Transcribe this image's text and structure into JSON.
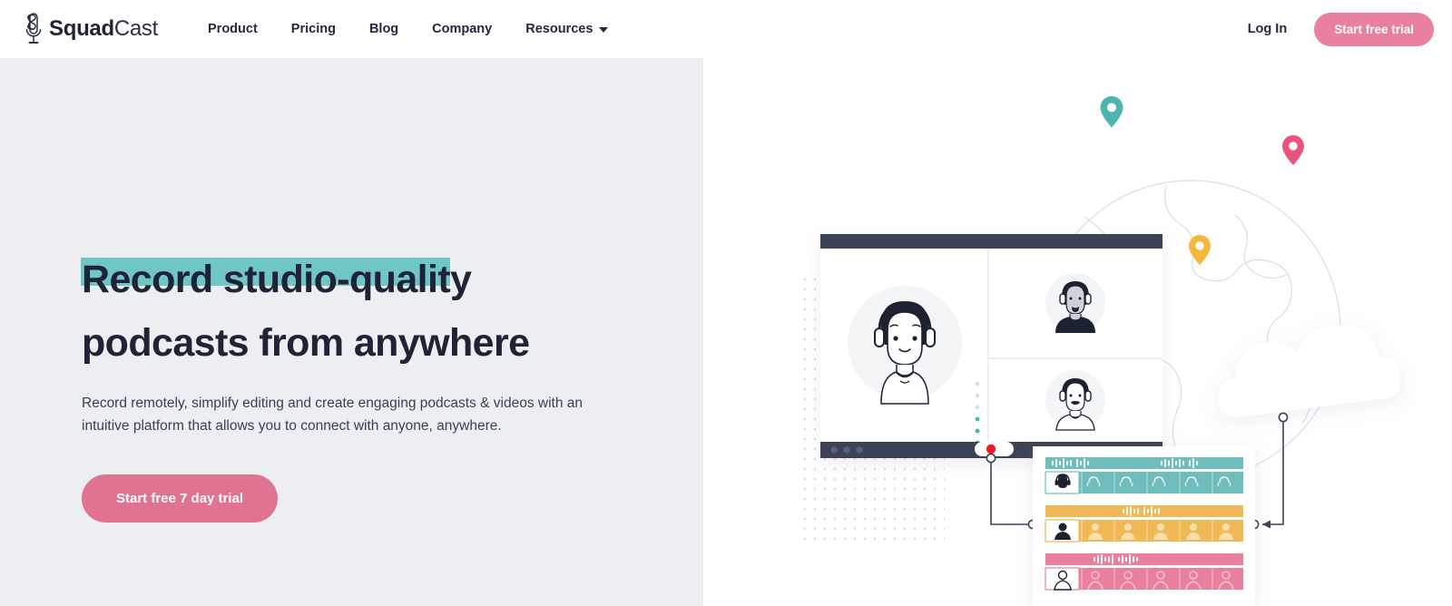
{
  "brand": {
    "name_bold": "Squad",
    "name_light": "Cast",
    "logo_icon": "microphone-icon"
  },
  "nav": {
    "links": [
      {
        "label": "Product",
        "has_caret": false
      },
      {
        "label": "Pricing",
        "has_caret": false
      },
      {
        "label": "Blog",
        "has_caret": false
      },
      {
        "label": "Company",
        "has_caret": false
      },
      {
        "label": "Resources",
        "has_caret": true
      }
    ],
    "login_label": "Log In",
    "trial_label": "Start free trial"
  },
  "hero": {
    "headline_line1": "Record studio-quality",
    "headline_line2": "podcasts from anywhere",
    "subcopy": "Record remotely, simplify editing and create engaging podcasts & videos with an intuitive platform that allows you to connect with anyone, anywhere.",
    "cta_label": "Start free 7 day trial"
  },
  "illustration": {
    "window": {
      "title_bar_color": "#3D4256",
      "record_dot_color": "#EE1C25",
      "participants": [
        {
          "name": "main-speaker-avatar",
          "position": "large-left"
        },
        {
          "name": "participant-avatar-1",
          "position": "top-right"
        },
        {
          "name": "participant-avatar-2",
          "position": "bottom-right"
        }
      ]
    },
    "timeline_tracks": [
      {
        "name": "track-teal",
        "color": "#6FBDBD",
        "clips": 6
      },
      {
        "name": "track-amber",
        "color": "#F0B955",
        "clips": 6
      },
      {
        "name": "track-pink",
        "color": "#E8809E",
        "clips": 6
      }
    ],
    "map_pins": [
      {
        "name": "map-pin-teal",
        "color": "#4FB3B0"
      },
      {
        "name": "map-pin-pink",
        "color": "#E8537D"
      },
      {
        "name": "map-pin-yellow",
        "color": "#F5B83D"
      }
    ],
    "cloud": {
      "name": "cloud-shape",
      "color": "#FFFFFF"
    },
    "globe": {
      "name": "globe-outline",
      "stroke": "#D8DAE0"
    }
  },
  "colors": {
    "panel_bg": "#EDEEF2",
    "teal_highlight": "#6FC6C4",
    "pink_accent": "#E0738F",
    "navy_text": "#1E2338"
  }
}
